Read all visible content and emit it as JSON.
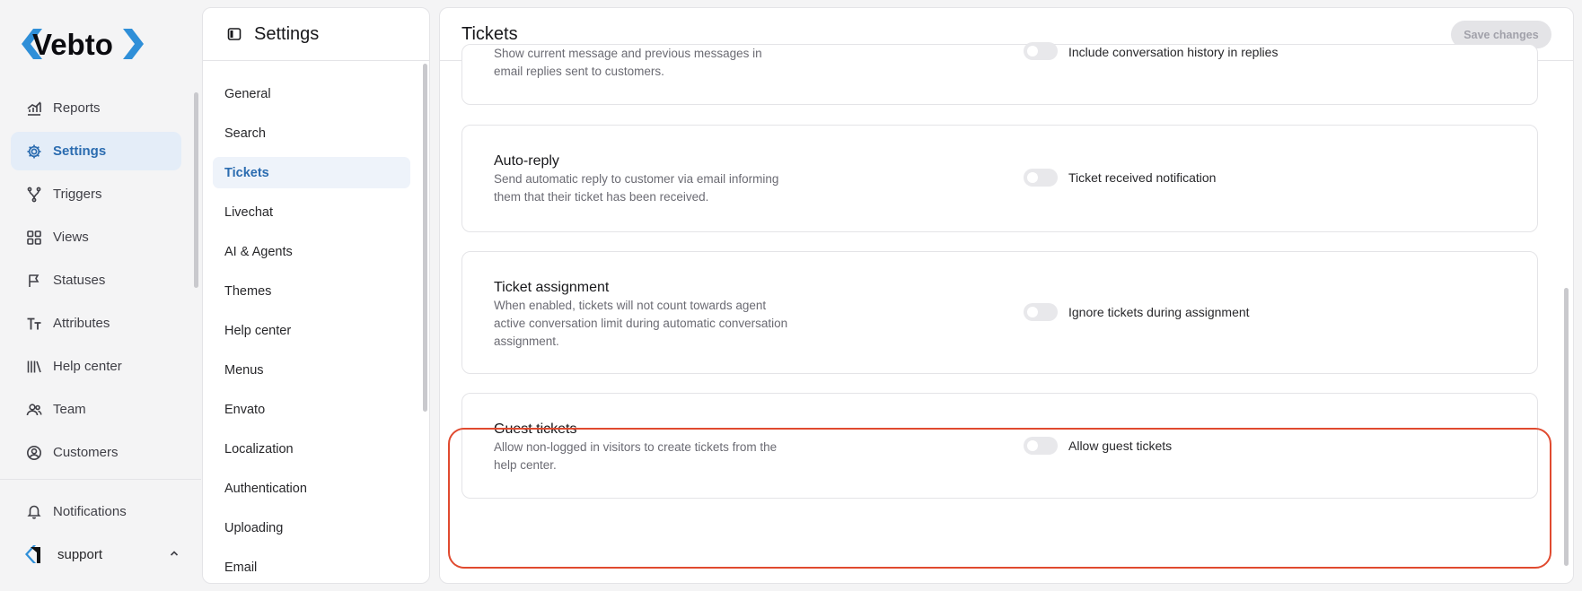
{
  "app": {
    "logo_text": "Vebto"
  },
  "leftnav": {
    "items": [
      {
        "label": "Reports",
        "icon": "chart-icon"
      },
      {
        "label": "Settings",
        "icon": "gear-icon",
        "active": true
      },
      {
        "label": "Triggers",
        "icon": "branch-icon"
      },
      {
        "label": "Views",
        "icon": "grid-icon"
      },
      {
        "label": "Statuses",
        "icon": "flag-icon"
      },
      {
        "label": "Attributes",
        "icon": "text-icon"
      },
      {
        "label": "Help center",
        "icon": "library-icon"
      },
      {
        "label": "Team",
        "icon": "users-icon"
      },
      {
        "label": "Customers",
        "icon": "user-circle-icon"
      }
    ],
    "notifications_label": "Notifications",
    "user_name": "support"
  },
  "settings_sidebar": {
    "title": "Settings",
    "items": [
      {
        "label": "General"
      },
      {
        "label": "Search"
      },
      {
        "label": "Tickets",
        "active": true
      },
      {
        "label": "Livechat"
      },
      {
        "label": "AI & Agents"
      },
      {
        "label": "Themes"
      },
      {
        "label": "Help center"
      },
      {
        "label": "Menus"
      },
      {
        "label": "Envato"
      },
      {
        "label": "Localization"
      },
      {
        "label": "Authentication"
      },
      {
        "label": "Uploading"
      },
      {
        "label": "Email"
      }
    ]
  },
  "main": {
    "title": "Tickets",
    "save_label": "Save changes",
    "cards": [
      {
        "desc": "Show current message and previous messages in email replies sent to customers.",
        "toggle_label": "Include conversation history in replies",
        "enabled": false
      },
      {
        "title": "Auto-reply",
        "desc": "Send automatic reply to customer via email informing them that their ticket has been received.",
        "toggle_label": "Ticket received notification",
        "enabled": false
      },
      {
        "title": "Ticket assignment",
        "desc": "When enabled, tickets will not count towards agent active conversation limit during automatic conversation assignment.",
        "toggle_label": "Ignore tickets during assignment",
        "enabled": false
      },
      {
        "title": "Guest tickets",
        "desc": "Allow non-logged in visitors to create tickets from the help center.",
        "toggle_label": "Allow guest tickets",
        "enabled": false
      }
    ]
  },
  "colors": {
    "accent": "#2b6cb0",
    "active_bg": "#e4edf8",
    "highlight": "#e04a2f",
    "logo_blue": "#2f8fd8"
  }
}
